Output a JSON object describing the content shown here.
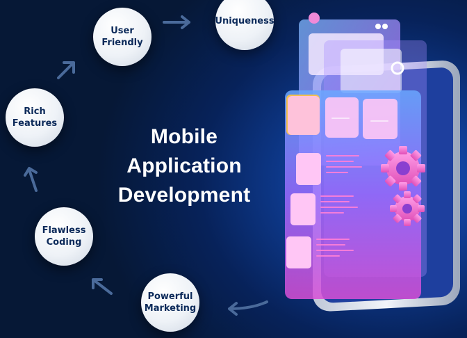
{
  "title": {
    "line1": "Mobile",
    "line2": "Application",
    "line3": "Development"
  },
  "features": [
    {
      "line1": "User",
      "line2": "Friendly"
    },
    {
      "line1": "Uniqueness"
    },
    {
      "line1": "Rich",
      "line2": "Features"
    },
    {
      "line1": "Flawless",
      "line2": "Coding"
    },
    {
      "line1": "Powerful",
      "line2": "Marketing"
    }
  ],
  "colors": {
    "background_dark": "#061836",
    "background_glow": "#1c5fd6",
    "circle": "#eef2f7",
    "circle_text": "#0c2a5a",
    "title_text": "#ffffff",
    "arrow": "#4a6a9a",
    "phone_accent": "#d94fd6"
  }
}
